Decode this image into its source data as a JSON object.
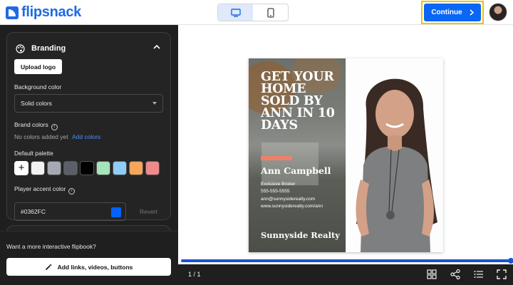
{
  "header": {
    "logo_text": "flipsnack",
    "views": [
      "desktop-view",
      "mobile-view"
    ],
    "active_view": "desktop-view",
    "continue_label": "Continue"
  },
  "sidebar": {
    "branding": {
      "title": "Branding",
      "upload_logo": "Upload logo",
      "background_color_label": "Background color",
      "background_color_value": "Solid colors",
      "brand_colors_label": "Brand colors",
      "no_colors": "No colors added yet",
      "add_colors": "Add colors",
      "default_palette_label": "Default palette",
      "palette": [
        "#f2f2f2",
        "#a5aab2",
        "#5b6068",
        "#000000",
        "#a6e5b9",
        "#8fcdf7",
        "#f5a55c",
        "#ef8a8a"
      ],
      "accent_label": "Player accent color",
      "accent_value": "#0362FC",
      "accent_color": "#0362FC",
      "revert": "Revert"
    },
    "footer": {
      "upsell_text": "Want a more interactive flipbook?",
      "links_button": "Add links, videos, buttons"
    }
  },
  "preview": {
    "flyer": {
      "headline": "GET YOUR HOME SOLD BY ANN IN 10 DAYS",
      "name": "Ann Campbell",
      "info": [
        "Exclusive Broker",
        "555-555-5555",
        "ann@sunnysiderealty.com",
        "www.sunnysiderealty.com/ann"
      ],
      "brand": "Sunnyside Realty"
    },
    "progress": 1.0,
    "page_count": "1 / 1",
    "player_icons": [
      "grid-icon",
      "share-icon",
      "list-icon",
      "fullscreen-icon"
    ]
  }
}
